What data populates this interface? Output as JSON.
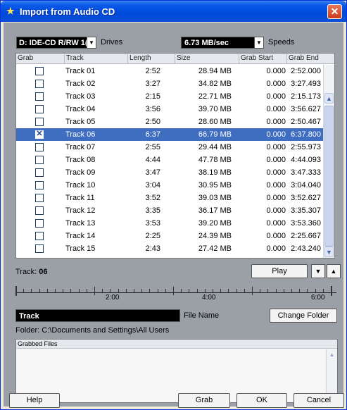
{
  "window": {
    "title": "Import from Audio CD"
  },
  "drive": {
    "value": "D: IDE-CD  R/RW 1(",
    "label": "Drives"
  },
  "speed": {
    "value": "6.73 MB/sec",
    "label": "Speeds"
  },
  "table": {
    "headers": [
      "Grab",
      "Track",
      "Length",
      "Size",
      "Grab Start",
      "Grab End"
    ],
    "rows": [
      {
        "grab": false,
        "track": "Track 01",
        "length": "2:52",
        "size": "28.94 MB",
        "start": "0.000",
        "end": "2:52.000"
      },
      {
        "grab": false,
        "track": "Track 02",
        "length": "3:27",
        "size": "34.82 MB",
        "start": "0.000",
        "end": "3:27.493"
      },
      {
        "grab": false,
        "track": "Track 03",
        "length": "2:15",
        "size": "22.71 MB",
        "start": "0.000",
        "end": "2:15.173"
      },
      {
        "grab": false,
        "track": "Track 04",
        "length": "3:56",
        "size": "39.70 MB",
        "start": "0.000",
        "end": "3:56.627"
      },
      {
        "grab": false,
        "track": "Track 05",
        "length": "2:50",
        "size": "28.60 MB",
        "start": "0.000",
        "end": "2:50.467"
      },
      {
        "grab": true,
        "track": "Track 06",
        "length": "6:37",
        "size": "66.79 MB",
        "start": "0.000",
        "end": "6:37.800",
        "selected": true
      },
      {
        "grab": false,
        "track": "Track 07",
        "length": "2:55",
        "size": "29.44 MB",
        "start": "0.000",
        "end": "2:55.973"
      },
      {
        "grab": false,
        "track": "Track 08",
        "length": "4:44",
        "size": "47.78 MB",
        "start": "0.000",
        "end": "4:44.093"
      },
      {
        "grab": false,
        "track": "Track 09",
        "length": "3:47",
        "size": "38.19 MB",
        "start": "0.000",
        "end": "3:47.333"
      },
      {
        "grab": false,
        "track": "Track 10",
        "length": "3:04",
        "size": "30.95 MB",
        "start": "0.000",
        "end": "3:04.040"
      },
      {
        "grab": false,
        "track": "Track 11",
        "length": "3:52",
        "size": "39.03 MB",
        "start": "0.000",
        "end": "3:52.627"
      },
      {
        "grab": false,
        "track": "Track 12",
        "length": "3:35",
        "size": "36.17 MB",
        "start": "0.000",
        "end": "3:35.307"
      },
      {
        "grab": false,
        "track": "Track 13",
        "length": "3:53",
        "size": "39.20 MB",
        "start": "0.000",
        "end": "3:53.360"
      },
      {
        "grab": false,
        "track": "Track 14",
        "length": "2:25",
        "size": "24.39 MB",
        "start": "0.000",
        "end": "2:25.667"
      },
      {
        "grab": false,
        "track": "Track 15",
        "length": "2:43",
        "size": "27.42 MB",
        "start": "0.000",
        "end": "2:43.240"
      }
    ]
  },
  "track_info": {
    "label": "Track:",
    "number": "06"
  },
  "play_label": "Play",
  "ruler": {
    "labels": [
      "2:00",
      "4:00",
      "6:00"
    ]
  },
  "file": {
    "name": "Track",
    "label": "File Name",
    "change_folder": "Change Folder",
    "folder": "Folder:  C:\\Documents and Settings\\All Users"
  },
  "grabbed": {
    "header": "Grabbed Files"
  },
  "buttons": {
    "help": "Help",
    "grab": "Grab",
    "ok": "OK",
    "cancel": "Cancel"
  },
  "colors": {
    "titlebar": "#0a5ae8",
    "selection": "#3f6dbf",
    "panel": "#9aa0a6"
  }
}
